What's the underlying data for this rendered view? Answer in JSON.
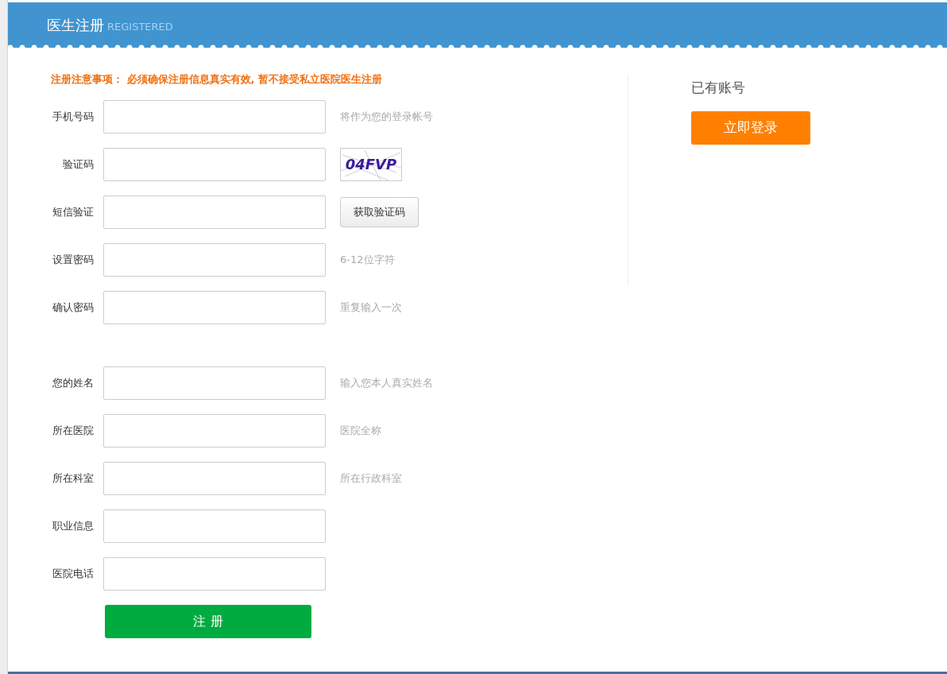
{
  "header": {
    "title": "医生注册",
    "subtitle": "REGISTERED"
  },
  "notice": "注册注意事项： 必须确保注册信息真实有效, 暂不接受私立医院医生注册",
  "account_fields": [
    {
      "kind": "hint",
      "label": "手机号码",
      "hint": "将作为您的登录帐号"
    },
    {
      "kind": "captcha",
      "label": "验证码",
      "captcha": "04FVP"
    },
    {
      "kind": "sms",
      "label": "短信验证",
      "button": "获取验证码"
    },
    {
      "kind": "hint",
      "label": "设置密码",
      "hint": "6-12位字符"
    },
    {
      "kind": "hint",
      "label": "确认密码",
      "hint": "重复输入一次"
    }
  ],
  "profile_fields": [
    {
      "kind": "hint",
      "label": "您的姓名",
      "hint": "输入您本人真实姓名"
    },
    {
      "kind": "hint",
      "label": "所在医院",
      "hint": "医院全称"
    },
    {
      "kind": "hint",
      "label": "所在科室",
      "hint": "所在行政科室"
    },
    {
      "kind": "plain",
      "label": "职业信息"
    },
    {
      "kind": "plain",
      "label": "医院电话"
    }
  ],
  "submit": "注 册",
  "login": {
    "title": "已有账号",
    "button": "立即登录"
  }
}
